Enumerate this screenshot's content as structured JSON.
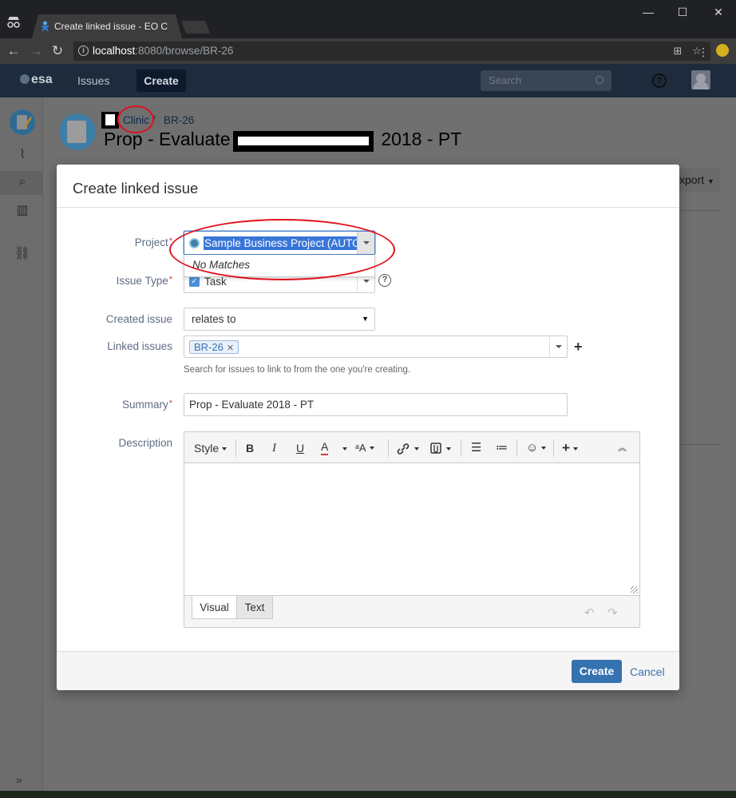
{
  "browser": {
    "tab_title": "Create linked issue - EO C",
    "url_host": "localhost",
    "url_rest": ":8080/browse/BR-26",
    "controls": {
      "minimize": "—",
      "maximize": "☐",
      "close": "✕"
    }
  },
  "jira_header": {
    "logo": "esa",
    "issues": "Issues",
    "create": "Create",
    "search_placeholder": "Search",
    "help": "?"
  },
  "issue_page": {
    "breadcrumb_project": "Clinic",
    "breadcrumb_separator": "/",
    "breadcrumb_key": "BR-26",
    "title_prefix": "Prop - Evaluate",
    "title_suffix": "2018 - PT",
    "export_label": "xport"
  },
  "dialog": {
    "title": "Create linked issue",
    "project": {
      "label": "Project",
      "value": "Sample Business Project (AUTO",
      "dropdown_message": "No Matches"
    },
    "issue_type": {
      "label": "Issue Type",
      "value": "Task"
    },
    "created_issue": {
      "label": "Created issue",
      "value": "relates to"
    },
    "linked_issues": {
      "label": "Linked issues",
      "tokens": [
        "BR-26"
      ],
      "help": "Search for issues to link to from the one you're creating."
    },
    "summary": {
      "label": "Summary",
      "value": "Prop - Evaluate 2018 - PT"
    },
    "description": {
      "label": "Description",
      "toolbar": {
        "style": "Style",
        "bold": "B",
        "italic": "I",
        "underline": "U",
        "color": "A"
      },
      "tabs": [
        "Visual",
        "Text"
      ]
    },
    "footer": {
      "create": "Create",
      "cancel": "Cancel"
    }
  },
  "colors": {
    "annotation_red": "#e0111d",
    "primary_button": "#3572b0",
    "link": "#3b73af",
    "selection": "#3875d7"
  }
}
